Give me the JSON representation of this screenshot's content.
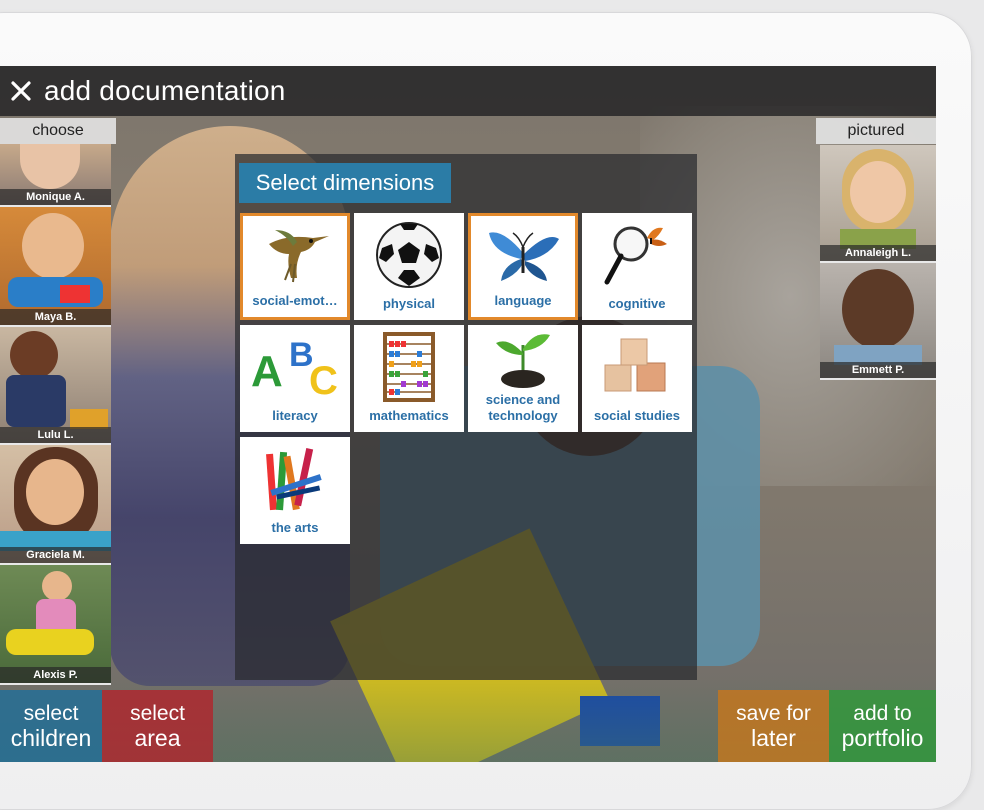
{
  "header": {
    "title": "add documentation"
  },
  "labels": {
    "choose": "choose",
    "pictured": "pictured"
  },
  "choose_children": [
    {
      "name": "Monique A."
    },
    {
      "name": "Maya B."
    },
    {
      "name": "Lulu L."
    },
    {
      "name": "Graciela M."
    },
    {
      "name": "Alexis P."
    }
  ],
  "pictured_children": [
    {
      "name": "Annaleigh L."
    },
    {
      "name": "Emmett P."
    }
  ],
  "dimensions": {
    "header": "Select dimensions",
    "tiles": [
      {
        "label": "social-emot…",
        "icon": "hummingbird-icon",
        "selected": true
      },
      {
        "label": "physical",
        "icon": "soccer-ball-icon",
        "selected": false
      },
      {
        "label": "language",
        "icon": "butterfly-icon",
        "selected": true
      },
      {
        "label": "cognitive",
        "icon": "magnifying-glass-icon",
        "selected": false
      },
      {
        "label": "literacy",
        "icon": "abc-letters-icon",
        "selected": false
      },
      {
        "label": "mathematics",
        "icon": "abacus-icon",
        "selected": false
      },
      {
        "label": "science and technology",
        "icon": "sprout-icon",
        "selected": false
      },
      {
        "label": "social studies",
        "icon": "blocks-icon",
        "selected": false
      },
      {
        "label": "the arts",
        "icon": "crayons-icon",
        "selected": false
      }
    ]
  },
  "actions": {
    "select_children": {
      "line1": "select",
      "line2": "children"
    },
    "select_area": {
      "line1": "select",
      "line2": "area"
    },
    "save_for_later": {
      "line1": "save for",
      "line2": "later"
    },
    "add_to_portfolio": {
      "line1": "add to",
      "line2": "portfolio"
    }
  },
  "colors": {
    "accent_blue": "#2b7ca6",
    "selected_border": "#e2892b",
    "btn_children": "#1f6e9a",
    "btn_area": "#b3222a",
    "btn_save": "#c9771a",
    "btn_portfolio": "#2f9a3a"
  }
}
